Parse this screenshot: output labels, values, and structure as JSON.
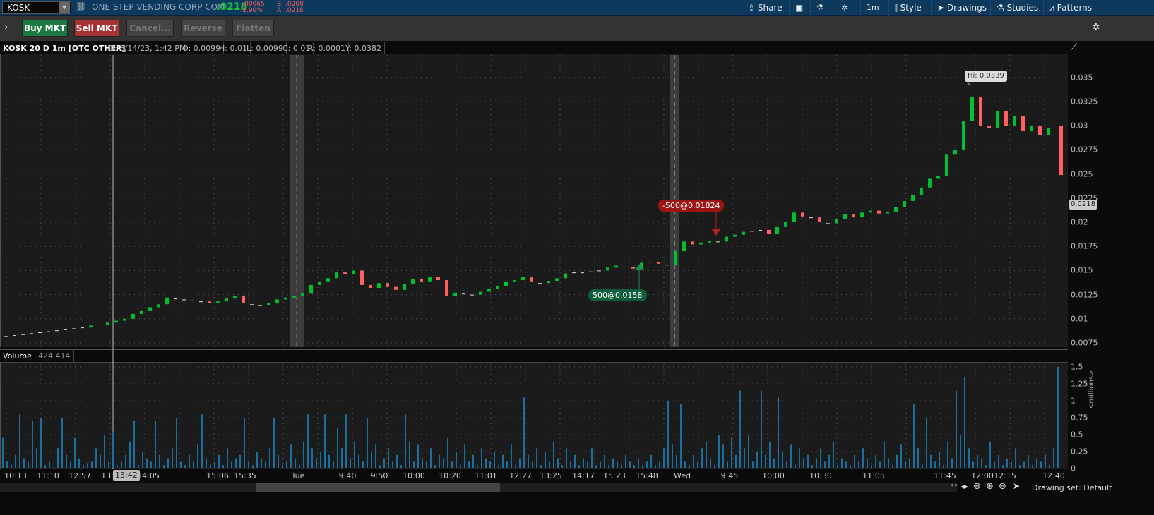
{
  "topbar": {
    "symbol": "KOSK",
    "company": "ONE STEP VENDING CORP COM",
    "last": ".0218",
    "change": "-.00065",
    "change_pct": "-2.90%",
    "bid": "B: .0200",
    "ask": "A: .0218",
    "share": "Share",
    "timeframe": "1m",
    "style": "Style",
    "drawings": "Drawings",
    "studies": "Studies",
    "patterns": "Patterns"
  },
  "toolbar": {
    "buy": "Buy MKT",
    "sell": "Sell MKT",
    "cancel": "Cancel...",
    "reverse": "Reverse",
    "flatten": "Flatten"
  },
  "header": {
    "title": "KOSK 20 D 1m [OTC OTHER]",
    "date": "D: 8/14/23, 1:42 PM",
    "open": "O: 0.0099",
    "high": "H: 0.01",
    "low": "L: 0.0099",
    "close": "C: 0.01",
    "range": "R: 0.0001",
    "y": "Y: 0.0382"
  },
  "volume_header": {
    "label": "Volume",
    "value": "424,414"
  },
  "annotations": {
    "hi": "Hi: 0.0339",
    "buy": "500@0.0158",
    "sell": "-500@0.01824",
    "last_price": "0.0218",
    "cursor_time": "13:42"
  },
  "footer": {
    "drawing_set": "Drawing set: Default",
    "volume_unit": "<millions>"
  },
  "colors": {
    "up": "#00c030",
    "down": "#ff6060",
    "volume": "#1a6fa0",
    "buy": "#0d5c3a",
    "sell": "#9c1414"
  },
  "chart_data": {
    "type": "candlestick",
    "y_ticks": [
      "0.0075",
      "0.01",
      "0.0125",
      "0.015",
      "0.0175",
      "0.02",
      "0.0225",
      "0.025",
      "0.0275",
      "0.03",
      "0.0325",
      "0.035"
    ],
    "ylim": [
      0.0075,
      0.035
    ],
    "x_ticks": [
      "10:13",
      "11:10",
      "12:57",
      "13:",
      "14:05",
      "15:06",
      "15:35",
      "Tue",
      "9:40",
      "9:50",
      "10:00",
      "10:20",
      "11:01",
      "12:27",
      "13:25",
      "14:17",
      "15:23",
      "15:48",
      "Wed",
      "9:45",
      "10:00",
      "10:30",
      "11:05",
      "11:45",
      "12:00",
      "12:15",
      "12:40"
    ],
    "first_open": 0.0081,
    "closes": [
      0.0082,
      0.0083,
      0.0084,
      0.0085,
      0.0086,
      0.0087,
      0.0088,
      0.0089,
      0.009,
      0.0091,
      0.0093,
      0.0094,
      0.0096,
      0.0098,
      0.01,
      0.0105,
      0.0108,
      0.0112,
      0.0115,
      0.0122,
      0.0121,
      0.012,
      0.0119,
      0.0118,
      0.0116,
      0.0118,
      0.0121,
      0.0124,
      0.0116,
      0.0115,
      0.0114,
      0.0116,
      0.012,
      0.0122,
      0.0124,
      0.0126,
      0.0135,
      0.0138,
      0.0142,
      0.0148,
      0.0146,
      0.015,
      0.0135,
      0.0132,
      0.0137,
      0.0133,
      0.013,
      0.0136,
      0.0141,
      0.0138,
      0.0143,
      0.014,
      0.0124,
      0.0127,
      0.0126,
      0.0125,
      0.0128,
      0.0131,
      0.0134,
      0.0138,
      0.014,
      0.0143,
      0.0138,
      0.0137,
      0.0139,
      0.0142,
      0.0147,
      0.0148,
      0.0148,
      0.0149,
      0.015,
      0.0153,
      0.0155,
      0.0154,
      0.0152,
      0.0158,
      0.0159,
      0.0157,
      0.0156,
      0.017,
      0.018,
      0.0177,
      0.0179,
      0.0181,
      0.018,
      0.0185,
      0.0187,
      0.019,
      0.0191,
      0.0192,
      0.0188,
      0.0195,
      0.02,
      0.021,
      0.0206,
      0.0205,
      0.02,
      0.0199,
      0.0203,
      0.0208,
      0.0205,
      0.021,
      0.0212,
      0.0209,
      0.0211,
      0.0216,
      0.0222,
      0.0228,
      0.0236,
      0.0245,
      0.0248,
      0.027,
      0.0275,
      0.0305,
      0.033,
      0.03,
      0.0298,
      0.0315,
      0.03,
      0.031,
      0.0295,
      0.03,
      0.029,
      0.0298,
      0.03,
      0.0249
    ],
    "high_bar": {
      "index": 114,
      "high": 0.0339
    },
    "volume_ticks": [
      "0",
      "0.25",
      "0.5",
      "0.75",
      "1",
      "1.25",
      "1.5"
    ],
    "volume_ylim": [
      0,
      1.5
    ],
    "volume": [
      0.45,
      0.1,
      0.05,
      0.2,
      0.8,
      0.15,
      0.1,
      0.7,
      0.3,
      0.75,
      0.05,
      0.1,
      0.02,
      0.3,
      0.75,
      0.2,
      0.1,
      0.45,
      0.15,
      0.05,
      0.08,
      0.1,
      0.3,
      0.2,
      0.5,
      0.1,
      0.55,
      0.05,
      0.1,
      0.2,
      0.4,
      0.7,
      0.05,
      0.25,
      0.15,
      0.1,
      0.7,
      0.2,
      0.05,
      0.15,
      0.3,
      0.75,
      0.1,
      0.05,
      0.2,
      0.1,
      0.35,
      0.8,
      0.15,
      0.05,
      0.1,
      0.2,
      0.05,
      0.3,
      0.1,
      0.15,
      0.2,
      0.75,
      0.1,
      0.05,
      0.25,
      0.15,
      0.1,
      0.3,
      0.75,
      0.2,
      0.05,
      0.1,
      0.35,
      0.15,
      0.05,
      0.4,
      0.8,
      0.3,
      0.15,
      0.25,
      0.8,
      0.2,
      0.1,
      0.6,
      0.3,
      0.8,
      0.15,
      0.4,
      0.2,
      0.1,
      0.75,
      0.25,
      0.35,
      0.05,
      0.15,
      0.3,
      0.1,
      0.2,
      0.05,
      0.8,
      0.4,
      0.1,
      0.35,
      0.15,
      0.1,
      0.3,
      0.05,
      0.2,
      0.15,
      0.45,
      0.1,
      0.25,
      0.05,
      0.35,
      0.1,
      0.2,
      0.05,
      0.3,
      0.15,
      0.1,
      0.25,
      0.05,
      0.2,
      0.1,
      0.35,
      0.05,
      0.15,
      1.05,
      0.2,
      0.1,
      0.3,
      0.05,
      0.25,
      0.1,
      0.4,
      0.15,
      0.05,
      0.3,
      0.1,
      0.2,
      0.05,
      0.15,
      0.1,
      0.3,
      0.05,
      0.1,
      0.2,
      0.05,
      0.15,
      0.1,
      0.05,
      0.2,
      0.1,
      0.05,
      0.15,
      0.05,
      0.1,
      0.2,
      0.05,
      0.1,
      0.3,
      1.0,
      0.35,
      0.2,
      0.95,
      0.1,
      0.05,
      0.2,
      0.1,
      0.3,
      0.4,
      0.15,
      0.05,
      0.5,
      0.35,
      0.1,
      0.45,
      0.2,
      1.15,
      0.3,
      0.5,
      0.1,
      0.25,
      1.15,
      0.2,
      0.4,
      0.15,
      1.05,
      0.25,
      0.1,
      0.35,
      0.05,
      0.3,
      0.15,
      0.2,
      0.05,
      0.15,
      0.3,
      0.1,
      0.2,
      0.4,
      0.05,
      0.15,
      0.1,
      0.05,
      0.2,
      0.1,
      0.3,
      0.15,
      0.05,
      0.2,
      0.1,
      0.4,
      0.15,
      0.05,
      0.2,
      0.35,
      0.1,
      0.15,
      0.95,
      0.3,
      0.05,
      0.75,
      0.2,
      0.1,
      0.25,
      0.05,
      0.4,
      0.15,
      1.15,
      0.5,
      1.35,
      0.3,
      0.1,
      0.2,
      0.15,
      0.05,
      0.4,
      0.1,
      0.2,
      0.05,
      0.15,
      0.1,
      0.3,
      0.05,
      0.1,
      0.2,
      0.05,
      0.15,
      0.1,
      0.2,
      0.05,
      0.3,
      1.5
    ]
  }
}
